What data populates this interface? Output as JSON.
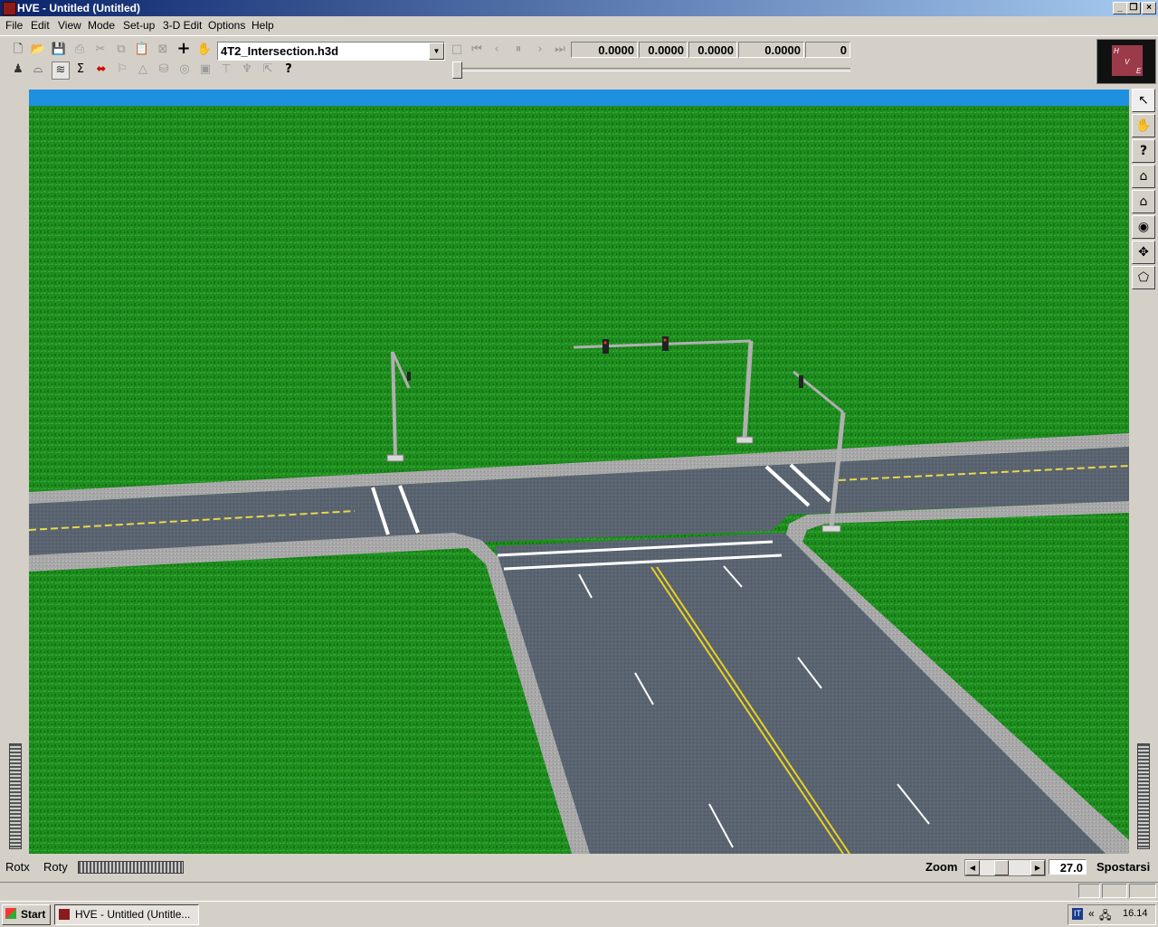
{
  "window": {
    "title": "HVE - Untitled (Untitled)",
    "controls": {
      "minimize": "_",
      "restore": "❐",
      "close": "×"
    }
  },
  "menu": [
    "File",
    "Edit",
    "View",
    "Mode",
    "Set-up",
    "3-D Edit",
    "Options",
    "Help"
  ],
  "toolbar": {
    "file_name": "4T2_Intersection.h3d",
    "readouts": [
      "0.0000",
      "0.0000",
      "0.0000",
      "0.0000",
      "0"
    ],
    "icons_row1": [
      "new-icon",
      "open-icon",
      "save-icon",
      "print-icon",
      "cut-icon",
      "copy-icon",
      "paste-icon",
      "delete-icon",
      "add-icon",
      "grab-icon"
    ],
    "icons_row2": [
      "human-icon",
      "vehicle-icon",
      "environment-icon",
      "sum-icon",
      "split-icon",
      "flag-icon",
      "cone-icon",
      "barrel-icon",
      "circle-icon",
      "box-icon",
      "sign-icon",
      "light-icon",
      "arrow-icon",
      "help-icon"
    ],
    "playback": [
      "stop-icon",
      "rewind-icon",
      "step-back-icon",
      "pause-icon",
      "step-forward-icon",
      "end-icon"
    ],
    "logo_letters": [
      "H",
      "V",
      "E"
    ]
  },
  "right_tools": [
    "select-arrow-icon",
    "hand-icon",
    "question-icon",
    "home-icon",
    "home-set-icon",
    "eye-icon",
    "move-icon",
    "perspective-icon"
  ],
  "bottom": {
    "rotx_label": "Rotx",
    "roty_label": "Roty",
    "zoom_label": "Zoom",
    "zoom_value": "27.0",
    "move_label": "Spostarsi"
  },
  "taskbar": {
    "start_label": "Start",
    "task_label": "HVE - Untitled (Untitle...",
    "tray_lang": "IT",
    "tray_time": "16.14"
  }
}
